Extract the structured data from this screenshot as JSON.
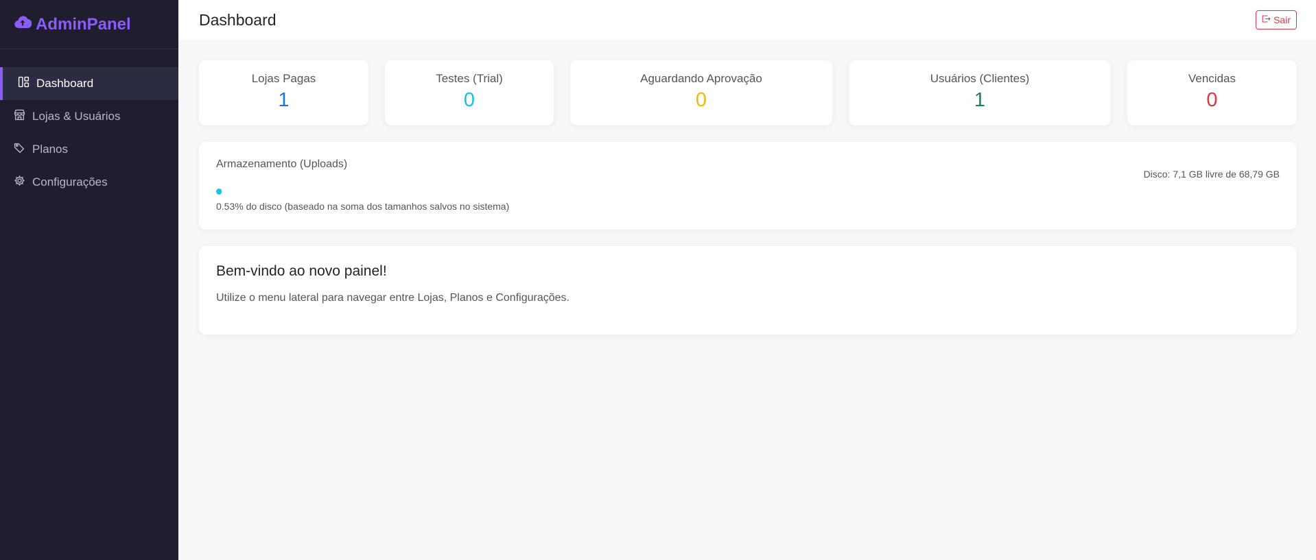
{
  "brand": {
    "name": "AdminPanel",
    "icon": "cloud-upload-icon",
    "color": "#8b5cf6"
  },
  "sidebar": {
    "items": [
      {
        "label": "Dashboard",
        "icon": "dashboard-icon",
        "active": true
      },
      {
        "label": "Lojas & Usuários",
        "icon": "shop-icon",
        "active": false
      },
      {
        "label": "Planos",
        "icon": "tags-icon",
        "active": false
      },
      {
        "label": "Configurações",
        "icon": "gear-icon",
        "active": false
      }
    ]
  },
  "header": {
    "title": "Dashboard",
    "logout_label": "Sair",
    "logout_icon": "box-arrow-right-icon"
  },
  "stats": [
    {
      "label": "Lojas Pagas",
      "value": "1",
      "color": "#1e73d8"
    },
    {
      "label": "Testes (Trial)",
      "value": "0",
      "color": "#17c1e8"
    },
    {
      "label": "Aguardando Aprovação",
      "value": "0",
      "color": "#f5b800"
    },
    {
      "label": "Usuários (Clientes)",
      "value": "1",
      "color": "#198754"
    },
    {
      "label": "Vencidas",
      "value": "0",
      "color": "#dc3545"
    }
  ],
  "storage": {
    "title": "Armazenamento (Uploads)",
    "disk_info": "Disco: 7,1 GB livre de 68,79 GB",
    "percent": 0.53,
    "note": "0.53% do disco (baseado na soma dos tamanhos salvos no sistema)",
    "bar_color": "#17c1e8"
  },
  "welcome": {
    "title": "Bem-vindo ao novo painel!",
    "text": "Utilize o menu lateral para navegar entre Lojas, Planos e Configurações."
  }
}
